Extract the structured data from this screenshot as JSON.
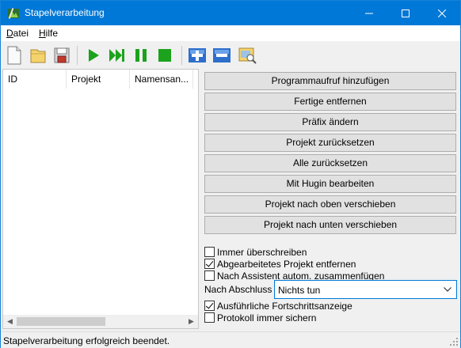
{
  "window": {
    "title": "Stapelverarbeitung"
  },
  "menu": {
    "items": [
      {
        "accel": "D",
        "rest": "atei"
      },
      {
        "accel": "H",
        "rest": "ilfe"
      }
    ]
  },
  "toolbar": {
    "icons": [
      "new-file-icon",
      "open-folder-icon",
      "save-icon",
      "play-icon",
      "skip-icon",
      "pause-icon",
      "stop-icon",
      "add-icon",
      "remove-icon",
      "edit-project-icon"
    ],
    "colors": {
      "green": "#1ca21c",
      "blue": "#2d6fcb"
    }
  },
  "listview": {
    "columns": [
      "ID",
      "Projekt",
      "Namensan..."
    ]
  },
  "actions": [
    "Programmaufruf hinzufügen",
    "Fertige entfernen",
    "Präfix ändern",
    "Projekt zurücksetzen",
    "Alle zurücksetzen",
    "Mit Hugin bearbeiten",
    "Projekt nach oben verschieben",
    "Projekt nach unten verschieben"
  ],
  "options": {
    "overwrite": {
      "label": "Immer überschreiben",
      "checked": false
    },
    "remove_done": {
      "label": "Abgearbeitetes Projekt entfernen",
      "checked": true
    },
    "auto_stitch": {
      "label": "Nach Assistent autom. zusammenfügen",
      "checked": false
    },
    "finish_label": "Nach Abschluss",
    "finish_value": "Nichts tun",
    "verbose": {
      "label": "Ausführliche Fortschrittsanzeige",
      "checked": true
    },
    "save_log": {
      "label": "Protokoll immer sichern",
      "checked": false
    }
  },
  "status": {
    "text": "Stapelverarbeitung erfolgreich beendet."
  }
}
